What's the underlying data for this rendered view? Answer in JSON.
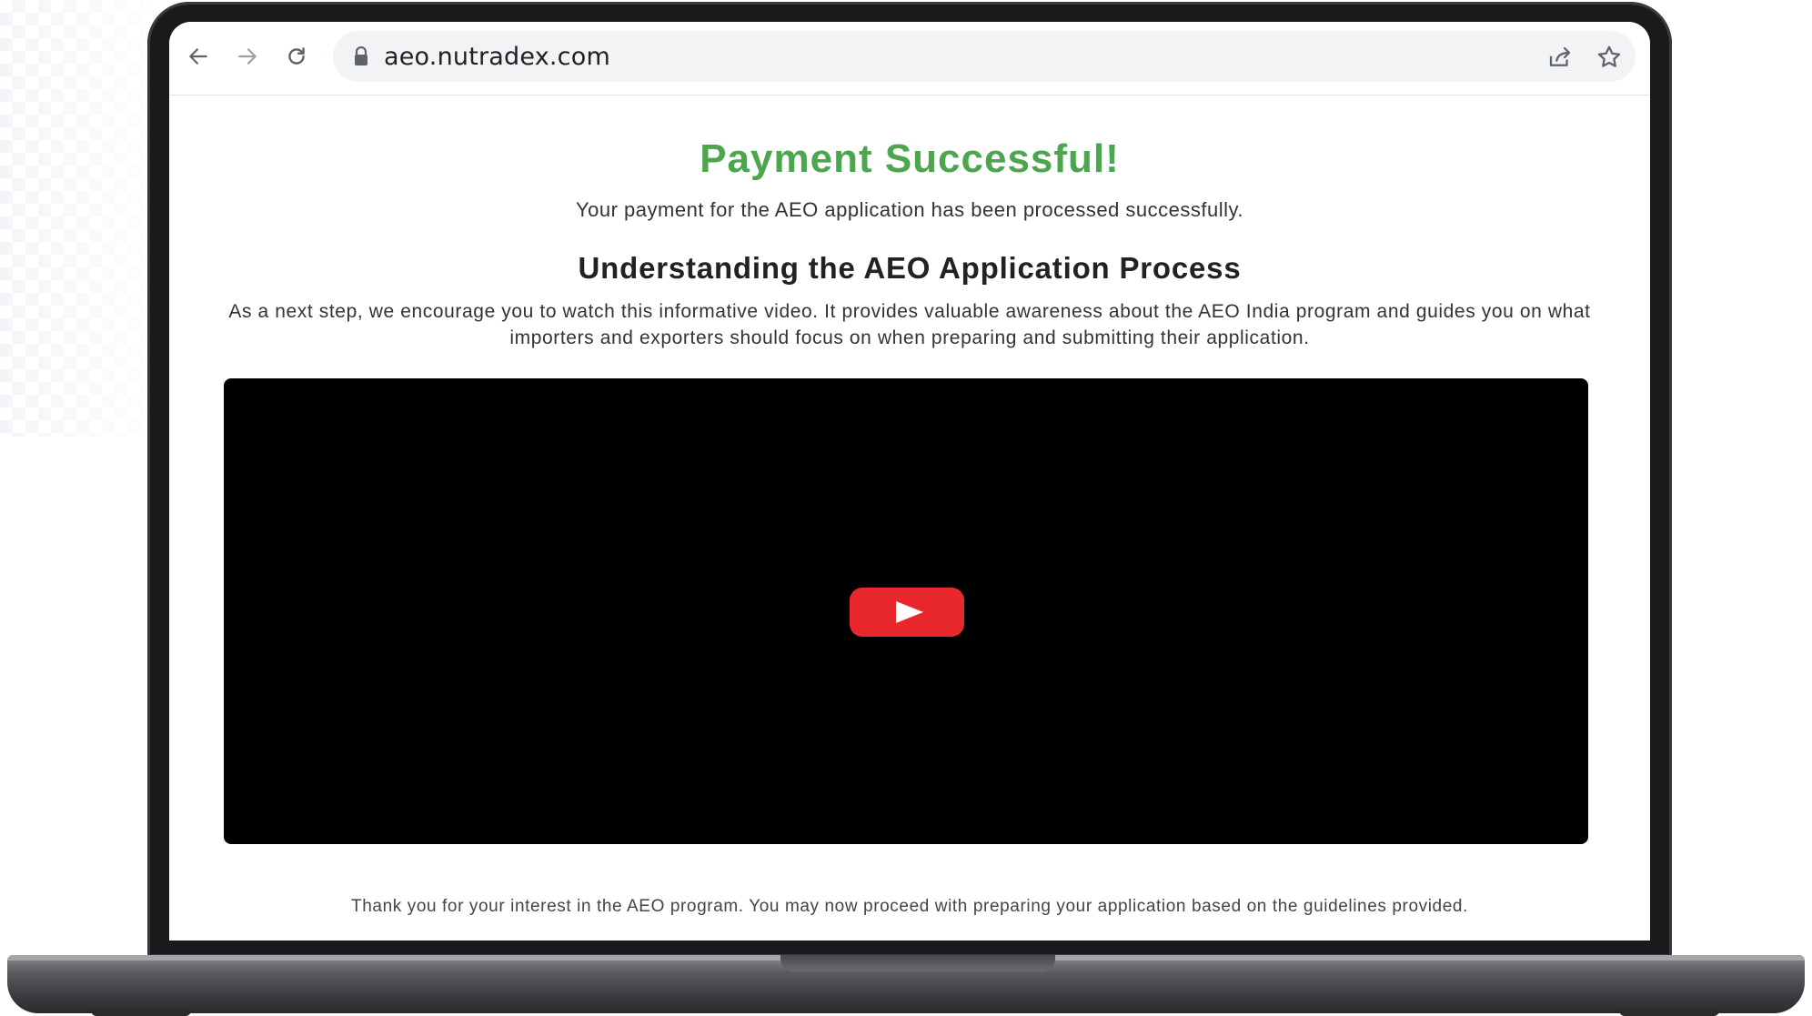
{
  "browser": {
    "url": "aeo.nutradex.com"
  },
  "page": {
    "title": "Payment Successful!",
    "subtitle": "Your payment for the AEO application has been processed successfully.",
    "heading": "Understanding the AEO Application Process",
    "description": "As a next step, we encourage you to watch this informative video. It provides valuable awareness about the AEO India program and guides you on what importers and exporters should focus on when preparing and submitting their application.",
    "thanks": "Thank you for your interest in the AEO program. You may now proceed with preparing your application based on the guidelines provided."
  },
  "colors": {
    "title_green": "#4ba64e",
    "play_red": "#e8282d"
  },
  "icons": {
    "back": "back-arrow-icon",
    "forward": "forward-arrow-icon",
    "reload": "reload-icon",
    "lock": "lock-icon",
    "share": "share-icon",
    "bookmark": "star-icon",
    "play": "play-icon"
  }
}
